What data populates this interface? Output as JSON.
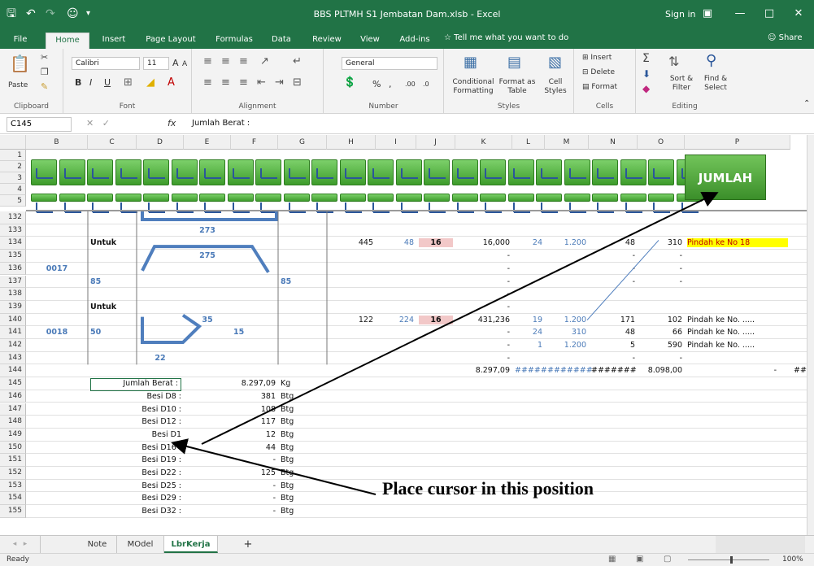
{
  "window": {
    "title": "BBS PLTMH S1 Jembatan Dam.xlsb - Excel",
    "sign_in": "Sign in",
    "icons": [
      "save-icon",
      "undo-icon",
      "redo-icon",
      "user-icon",
      "customize-icon",
      "ribbon-display-icon",
      "minimize-icon",
      "maximize-icon",
      "close-icon"
    ]
  },
  "menu": {
    "tabs": [
      "File",
      "Home",
      "Insert",
      "Page Layout",
      "Formulas",
      "Data",
      "Review",
      "View",
      "Add-ins"
    ],
    "active": "Home",
    "tell_me": "Tell me what you want to do",
    "share": "Share"
  },
  "ribbon": {
    "clipboard": {
      "label": "Clipboard",
      "paste": "Paste"
    },
    "font": {
      "label": "Font",
      "name": "Calibri",
      "size": "11",
      "bold": "B",
      "italic": "I",
      "underline": "U",
      "grow": "A",
      "shrink": "A"
    },
    "alignment": {
      "label": "Alignment"
    },
    "number": {
      "label": "Number",
      "format": "General",
      "percent": "%",
      "comma": ",",
      "inc": ".00",
      "dec": ".0"
    },
    "styles": {
      "label": "Styles",
      "conditional": "Conditional",
      "formatting": "Formatting",
      "format_as": "Format as",
      "table": "Table",
      "cell": "Cell",
      "styles": "Styles"
    },
    "cells": {
      "label": "Cells",
      "insert": "Insert",
      "delete": "Delete",
      "format": "Format"
    },
    "editing": {
      "label": "Editing",
      "sort": "Sort &",
      "filter": "Filter",
      "find": "Find &",
      "select": "Select"
    }
  },
  "formula_bar": {
    "name_box": "C145",
    "fx": "fx",
    "formula": "Jumlah Berat :"
  },
  "columns": [
    "B",
    "C",
    "D",
    "E",
    "F",
    "G",
    "H",
    "I",
    "J",
    "K",
    "L",
    "M",
    "N",
    "O",
    "P"
  ],
  "top_rows": [
    "1",
    "2",
    "3",
    "4",
    "5"
  ],
  "button": {
    "label": "JUMLAH"
  },
  "rows": [
    {
      "n": "132"
    },
    {
      "n": "133",
      "e": "273"
    },
    {
      "n": "134",
      "c": "Untuk",
      "h": "445",
      "i": "48",
      "j": "16",
      "k": "16,000",
      "l": "24",
      "m": "1.200",
      "nn": "48",
      "o": "310",
      "p": "Pindah ke No 18"
    },
    {
      "n": "135",
      "e": "275",
      "k": "-",
      "nn": "-",
      "o": "-"
    },
    {
      "n": "136",
      "b": "0017",
      "k": "-",
      "nn": "-",
      "o": "-"
    },
    {
      "n": "137",
      "c": "85",
      "g": "85",
      "k": "-",
      "nn": "-",
      "o": "-"
    },
    {
      "n": "138",
      "k": "-"
    },
    {
      "n": "139",
      "c": "Untuk",
      "k": "-"
    },
    {
      "n": "140",
      "e": "35",
      "h": "122",
      "i": "224",
      "j": "16",
      "k": "431,236",
      "l": "19",
      "m": "1.200",
      "nn": "171",
      "o": "102",
      "p": "Pindah ke No. ....."
    },
    {
      "n": "141",
      "b": "0018",
      "c": "50",
      "f": "15",
      "k": "-",
      "l": "24",
      "m": "310",
      "nn": "48",
      "o": "66",
      "p": "Pindah ke No. ....."
    },
    {
      "n": "142",
      "k": "-",
      "l": "1",
      "m": "1.200",
      "nn": "5",
      "o": "590",
      "p": "Pindah ke No. ....."
    },
    {
      "n": "143",
      "d": "22",
      "k": "-",
      "nn": "-",
      "o": "-"
    },
    {
      "n": "144",
      "k": "8.297,09",
      "l": "#####",
      "m": "#######",
      "nn": "#######",
      "o": "8.098,00",
      "p": "-",
      "q": "##"
    },
    {
      "n": "145",
      "label": "Jumlah Berat :",
      "val": "8.297,09",
      "unit": "Kg"
    },
    {
      "n": "146",
      "label": "Besi D8 :",
      "val": "381",
      "unit": "Btg"
    },
    {
      "n": "147",
      "label": "Besi D10 :",
      "val": "108",
      "unit": "Btg"
    },
    {
      "n": "148",
      "label": "Besi D12 :",
      "val": "117",
      "unit": "Btg"
    },
    {
      "n": "149",
      "label": "Besi D1",
      "val": "12",
      "unit": "Btg"
    },
    {
      "n": "150",
      "label": "Besi D16 :",
      "val": "44",
      "unit": "Btg"
    },
    {
      "n": "151",
      "label": "Besi D19 :",
      "val": "-",
      "unit": "Btg"
    },
    {
      "n": "152",
      "label": "Besi D22 :",
      "val": "125",
      "unit": "Btg"
    },
    {
      "n": "153",
      "label": "Besi D25 :",
      "val": "-",
      "unit": "Btg"
    },
    {
      "n": "154",
      "label": "Besi D29 :",
      "val": "-",
      "unit": "Btg"
    },
    {
      "n": "155",
      "label": "Besi D32 :",
      "val": "-",
      "unit": "Btg"
    }
  ],
  "sheet_tabs": [
    "Note",
    "MOdel",
    "LbrKerja"
  ],
  "active_sheet": "LbrKerja",
  "add_sheet": "+",
  "status": "Ready",
  "zoom": "100%",
  "annotation": "Place cursor in this position"
}
